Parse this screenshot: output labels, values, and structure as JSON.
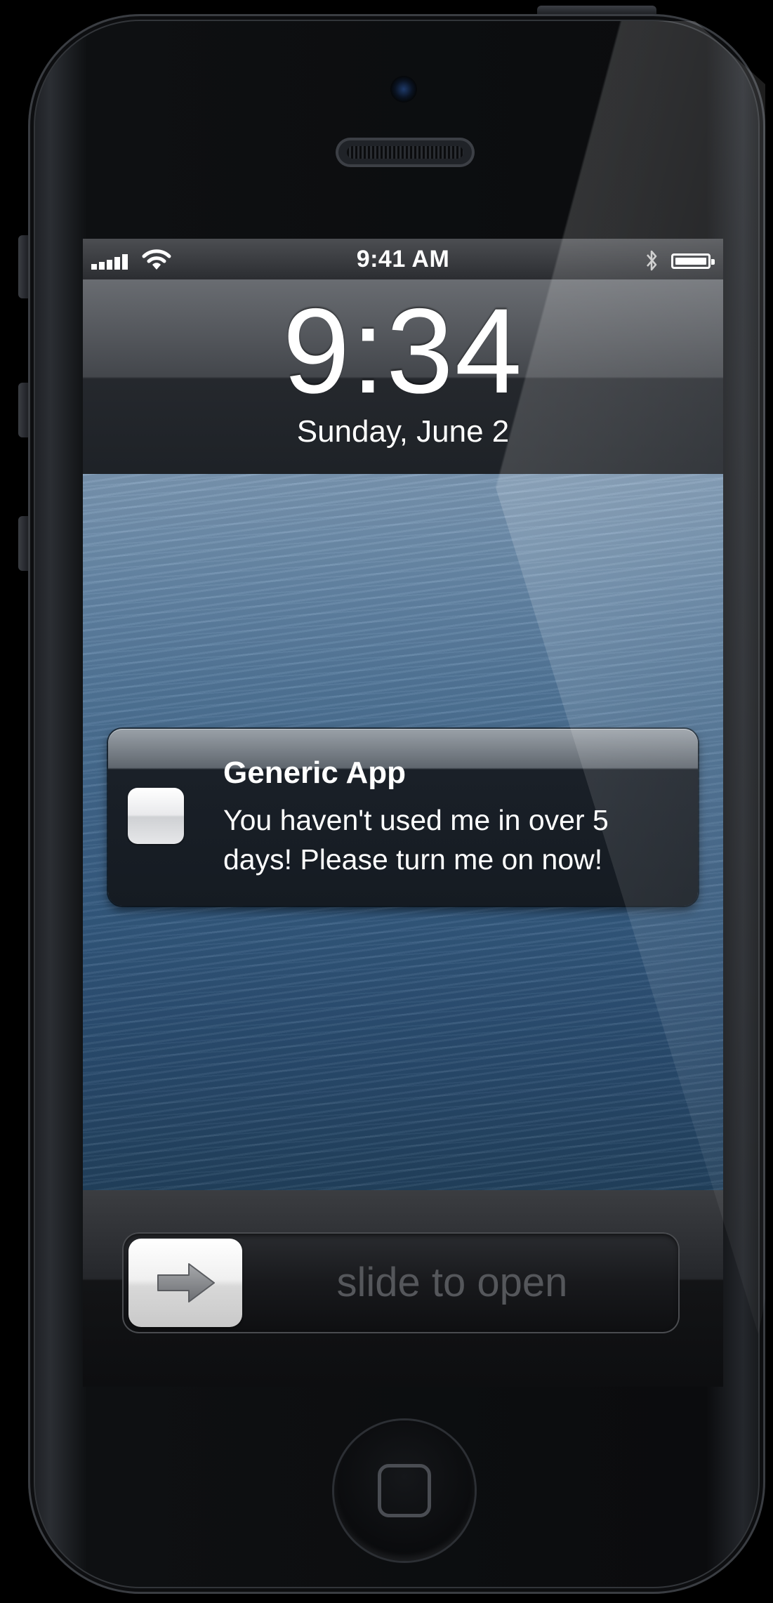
{
  "device": {
    "frame_color": "#0b0c0e",
    "accent": "#1e3a6a"
  },
  "status_bar": {
    "time": "9:41 AM",
    "signal_icon": "signal-bars-icon",
    "wifi_icon": "wifi-icon",
    "bluetooth_icon": "bluetooth-icon",
    "battery_icon": "battery-icon",
    "battery_level": 1.0
  },
  "lock_screen": {
    "time": "9:34",
    "date": "Sunday, June 2"
  },
  "notification": {
    "app_icon": "app-icon",
    "app_name": "Generic App",
    "message": "You haven't used me in over 5 days!  Please turn me on now!"
  },
  "unlock": {
    "label": "slide to open",
    "knob_icon": "arrow-right-icon"
  },
  "home_button": {
    "icon": "home-square-icon"
  }
}
